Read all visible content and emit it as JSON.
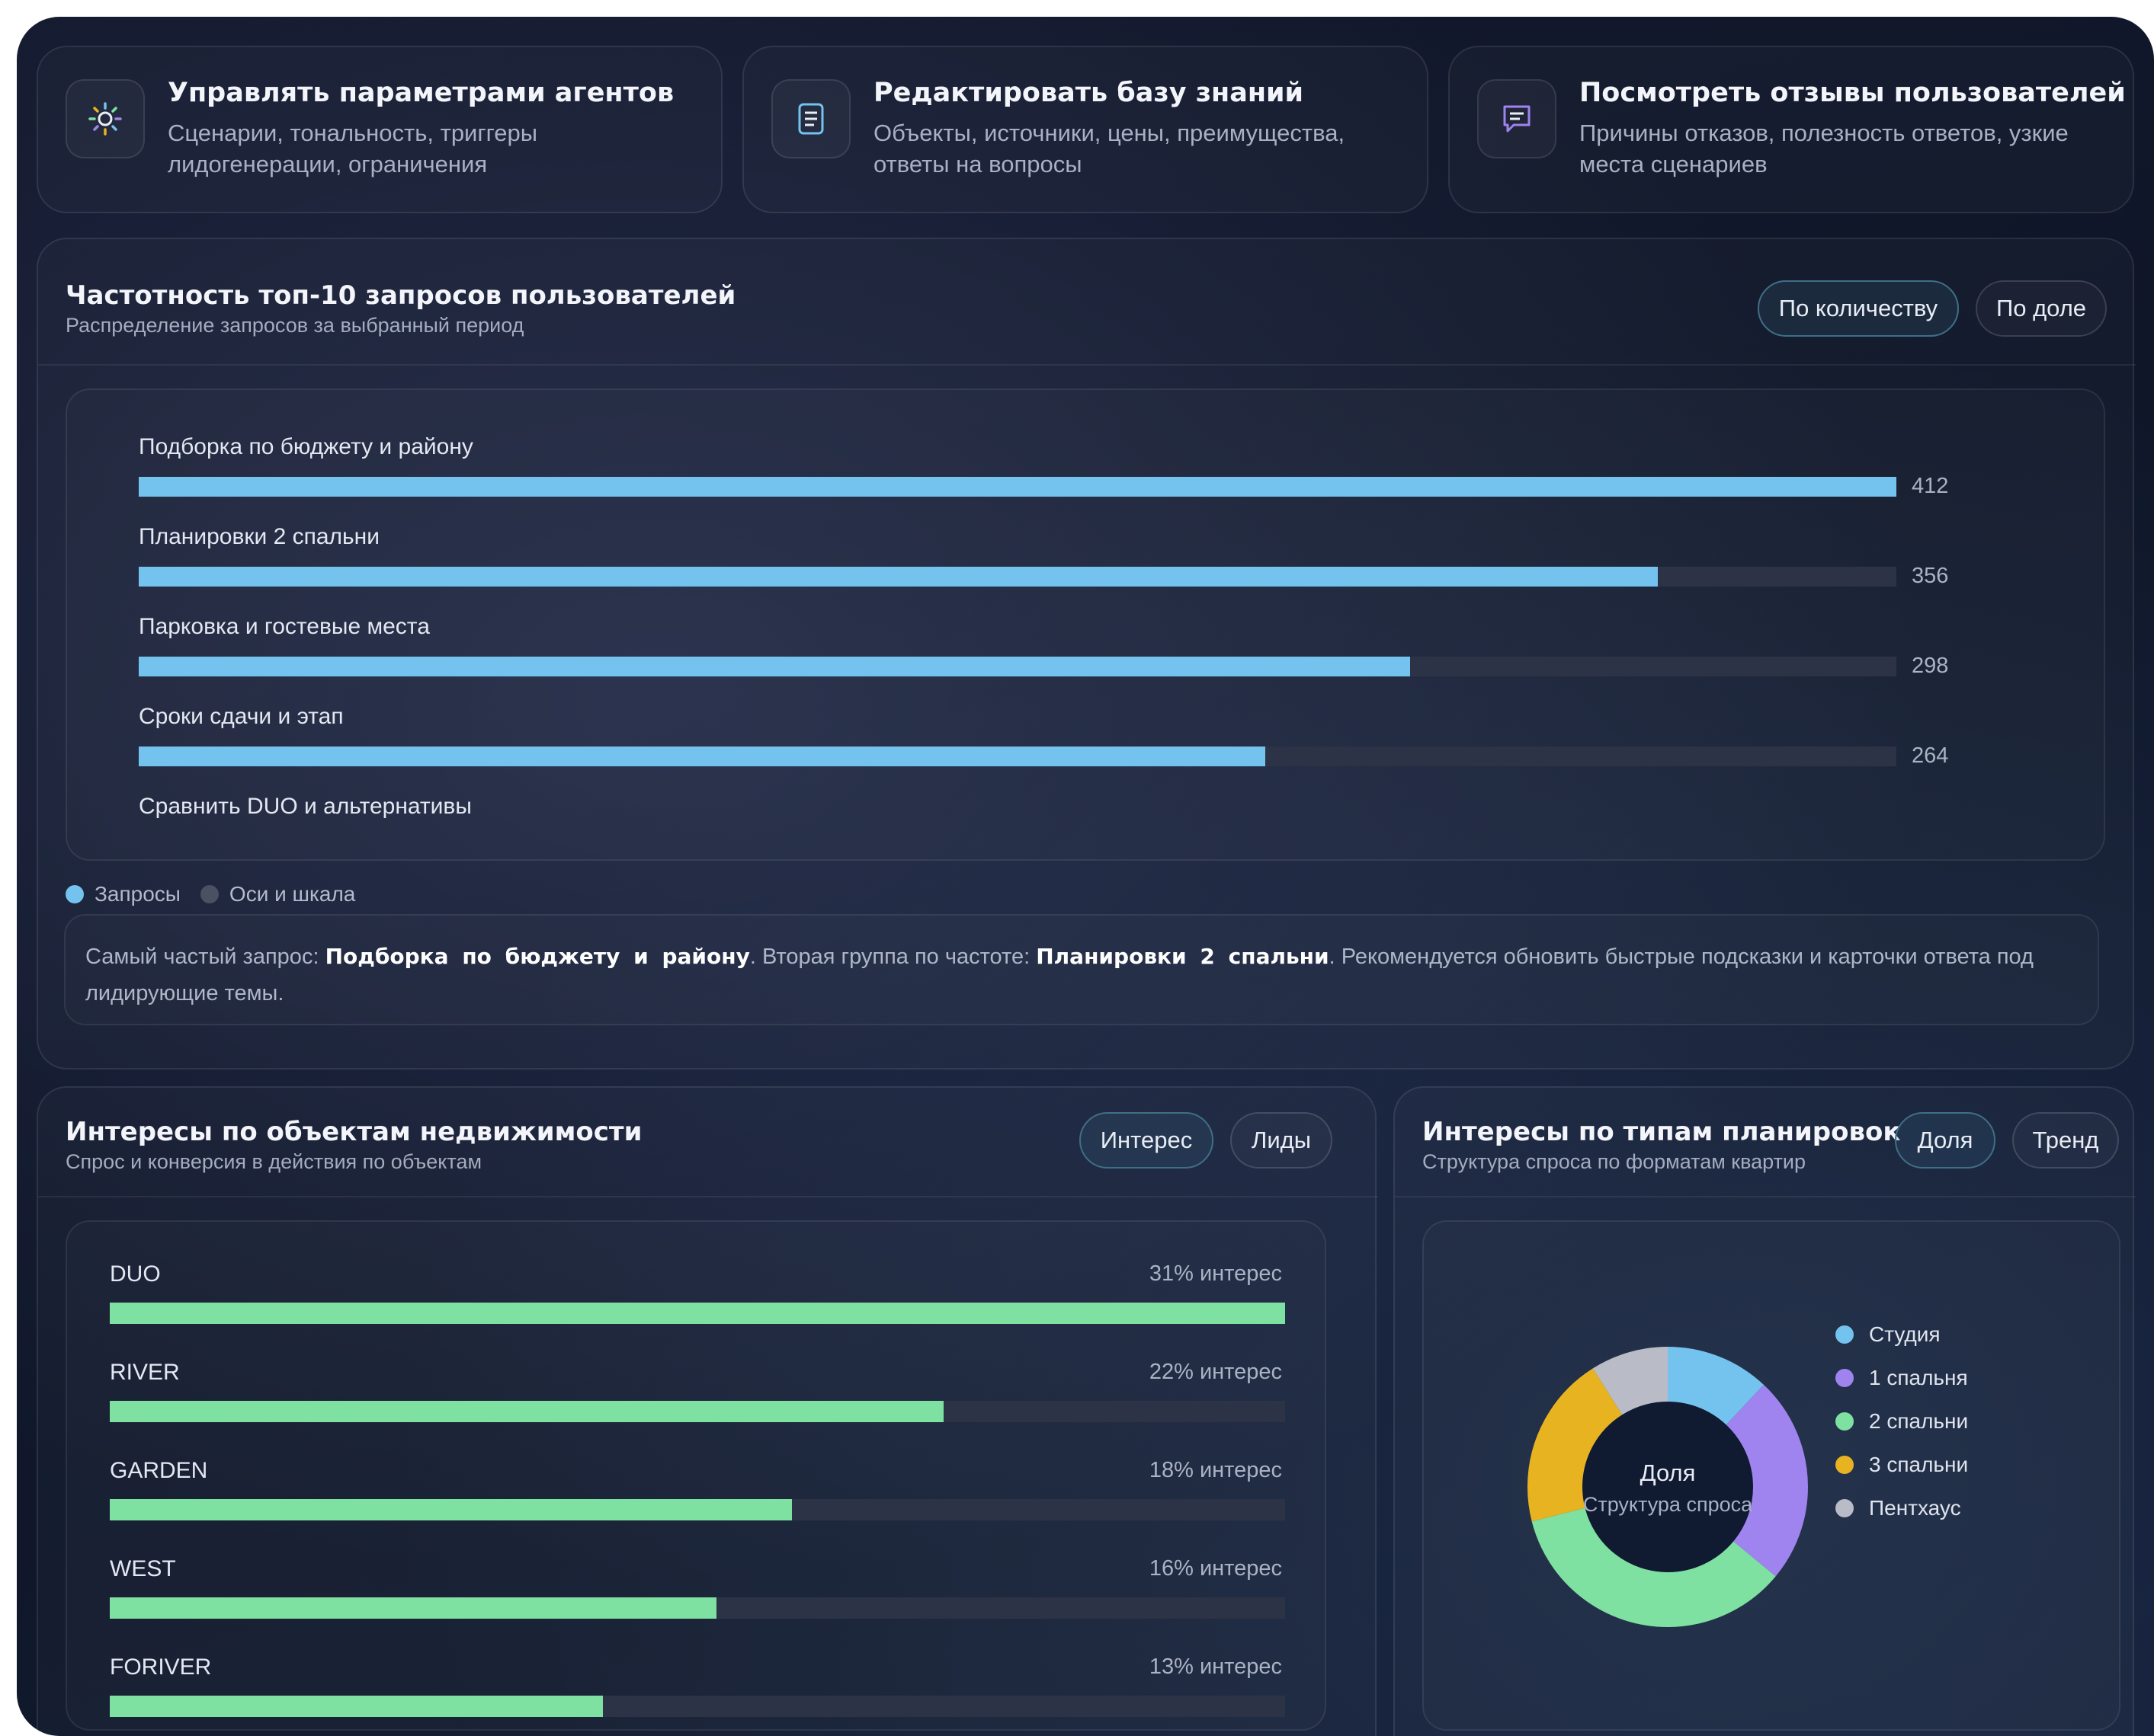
{
  "cards": [
    {
      "title": "Управлять параметрами агентов",
      "desc": "Сценарии, тональность, триггеры лидогенерации, ограничения",
      "icon": "gear-icon"
    },
    {
      "title": "Редактировать базу знаний",
      "desc": "Объекты, источники, цены, преимущества, ответы на вопросы",
      "icon": "document-icon"
    },
    {
      "title": "Посмотреть отзывы пользователей",
      "desc": "Причины отказов, полезность ответов, узкие места сценариев",
      "icon": "chat-icon"
    }
  ],
  "top_queries": {
    "title": "Частотность топ-10 запросов пользователей",
    "subtitle": "Распределение запросов за выбранный период",
    "toggle": [
      "По количеству",
      "По доле"
    ],
    "legend": [
      "Запросы",
      "Оси и шкала"
    ],
    "note": {
      "prefix": "Самый частый запрос: ",
      "top": "Подборка по бюджету и району",
      "middle": ". Вторая группа по частоте: ",
      "second": "Планировки 2 спальни",
      "suffix": ". Рекомендуется обновить быстрые подсказки и карточки ответа под лидирующие темы."
    }
  },
  "objects": {
    "title": "Интересы по объектам недвижимости",
    "subtitle": "Спрос и конверсия в действия по объектам",
    "toggle": [
      "Интерес",
      "Лиды"
    ]
  },
  "layouts": {
    "title": "Интересы по типам планировок",
    "subtitle": "Структура спроса по форматам квартир",
    "toggle": [
      "Доля",
      "Тренд"
    ],
    "center_title": "Доля",
    "center_sub": "Структура спроса"
  },
  "colors": {
    "queries": "#74c2ee",
    "axes": "#4a5162",
    "objects": "#7ee0a1"
  },
  "chart_data": [
    {
      "type": "bar",
      "orientation": "horizontal",
      "categories": [
        "Подборка по бюджету и району",
        "Планировки 2 спальни",
        "Парковка и гостевые места",
        "Сроки сдачи и этап",
        "Сравнить DUO и альтернативы"
      ],
      "values": [
        412,
        356,
        298,
        264,
        null
      ],
      "xlim": [
        0,
        412
      ]
    },
    {
      "type": "bar",
      "orientation": "horizontal",
      "categories": [
        "DUO",
        "RIVER",
        "GARDEN",
        "WEST",
        "FORIVER"
      ],
      "values": [
        31,
        22,
        18,
        16,
        13
      ],
      "labels": [
        "31% интерес",
        "22% интерес",
        "18% интерес",
        "16% интерес",
        "13% интерес"
      ],
      "xlim": [
        0,
        31
      ]
    },
    {
      "type": "pie",
      "donut": true,
      "categories": [
        "Студия",
        "1 спальня",
        "2 спальни",
        "3 спальни",
        "Пентхаус"
      ],
      "values": [
        12,
        24,
        35,
        20,
        9
      ],
      "colors": [
        "#74c2ee",
        "#9f83ef",
        "#7ee0a1",
        "#e8b321",
        "#b9bcc7"
      ]
    }
  ]
}
